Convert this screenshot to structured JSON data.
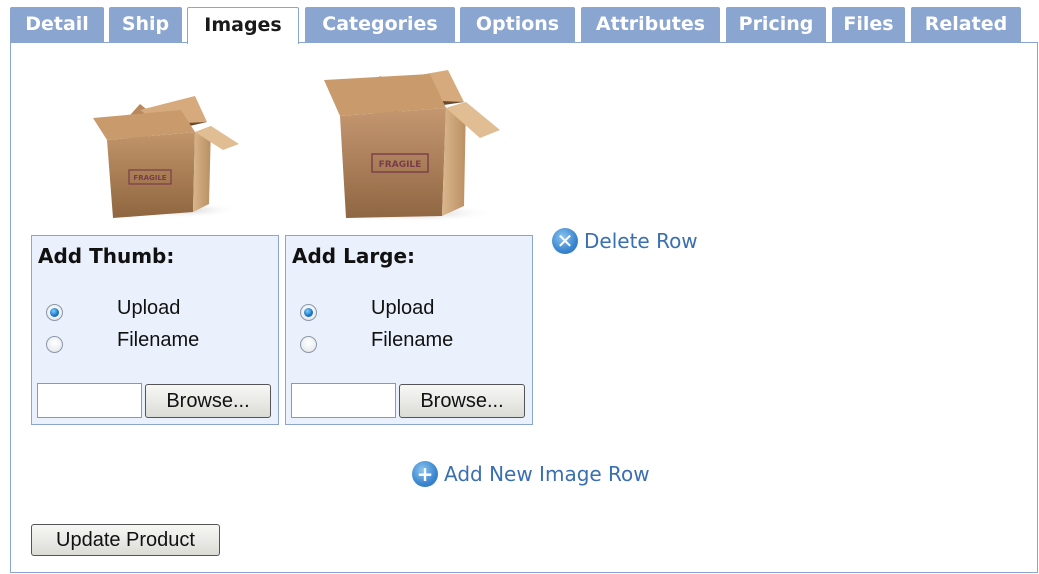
{
  "tabs": [
    {
      "label": "Detail",
      "active": false
    },
    {
      "label": "Ship",
      "active": false
    },
    {
      "label": "Images",
      "active": true
    },
    {
      "label": "Categories",
      "active": false
    },
    {
      "label": "Options",
      "active": false
    },
    {
      "label": "Attributes",
      "active": false
    },
    {
      "label": "Pricing",
      "active": false
    },
    {
      "label": "Files",
      "active": false
    },
    {
      "label": "Related",
      "active": false
    }
  ],
  "images": {
    "thumb_box_label": "FRAGILE",
    "large_box_label": "FRAGILE"
  },
  "thumb": {
    "title": "Add Thumb:",
    "option_upload": "Upload",
    "option_filename": "Filename",
    "selected": "upload",
    "file_value": "",
    "browse_label": "Browse..."
  },
  "large": {
    "title": "Add Large:",
    "option_upload": "Upload",
    "option_filename": "Filename",
    "selected": "upload",
    "file_value": "",
    "browse_label": "Browse..."
  },
  "actions": {
    "delete_row": "Delete Row",
    "add_row": "Add New Image Row",
    "update_product": "Update Product"
  },
  "colors": {
    "tab_bg": "#8aa5cf",
    "panel_border": "#8aa5cf",
    "addbox_bg": "#eaf1fc",
    "link": "#3a6fb0"
  },
  "icons": {
    "delete": "delete-circle-icon",
    "add": "add-circle-icon"
  }
}
